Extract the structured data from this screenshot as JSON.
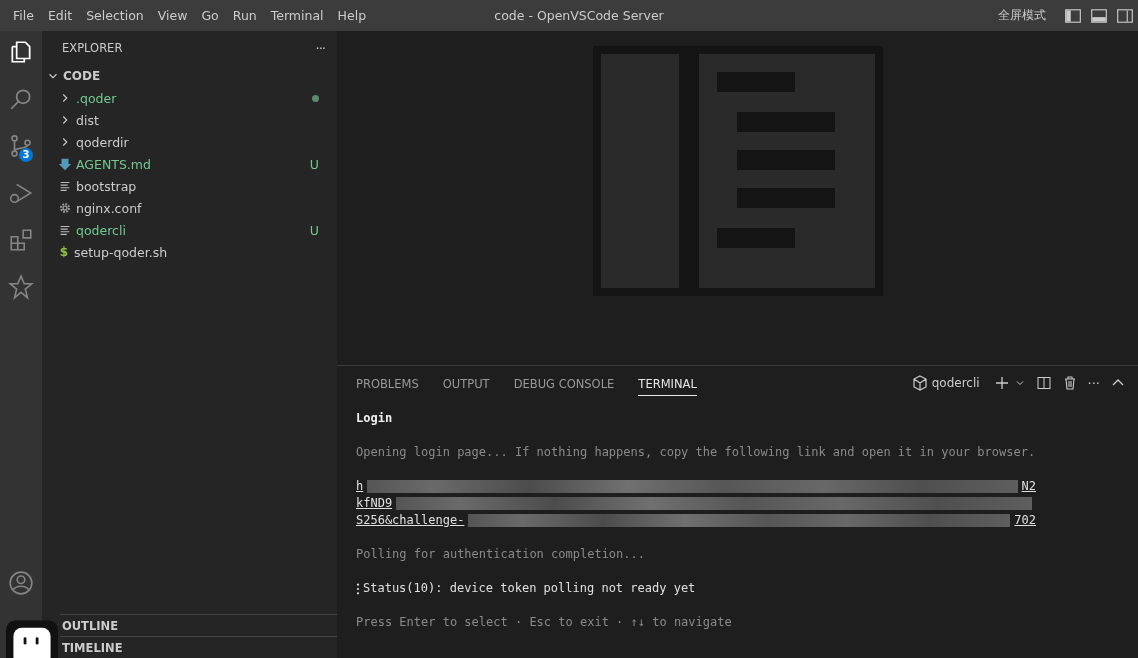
{
  "menu": [
    "File",
    "Edit",
    "Selection",
    "View",
    "Go",
    "Run",
    "Terminal",
    "Help"
  ],
  "window": {
    "title": "code - OpenVSCode Server",
    "fullscreen": "全屏模式"
  },
  "activity": [
    {
      "kind": "files",
      "selected": true
    },
    {
      "kind": "search",
      "selected": false
    },
    {
      "kind": "scm",
      "selected": false,
      "badge": "3"
    },
    {
      "kind": "debug",
      "selected": false
    },
    {
      "kind": "extensions",
      "selected": false
    },
    {
      "kind": "ai",
      "selected": false
    }
  ],
  "sidebar": {
    "title": "EXPLORER",
    "more": "···",
    "root": "CODE",
    "expanded": true,
    "items": [
      {
        "name": ".qoder",
        "kind": "folder",
        "untracked": true,
        "dot": true
      },
      {
        "name": "dist",
        "kind": "folder",
        "untracked": false
      },
      {
        "name": "qoderdir",
        "kind": "folder",
        "untracked": false
      },
      {
        "name": "AGENTS.md",
        "kind": "markdown",
        "untracked": true,
        "badge": "U"
      },
      {
        "name": "bootstrap",
        "kind": "text",
        "untracked": false
      },
      {
        "name": "nginx.conf",
        "kind": "config",
        "untracked": false
      },
      {
        "name": "qodercli",
        "kind": "text",
        "untracked": true,
        "badge": "U"
      },
      {
        "name": "setup-qoder.sh",
        "kind": "shell",
        "untracked": false,
        "glyph": "$"
      }
    ],
    "sections": [
      "OUTLINE",
      "TIMELINE"
    ]
  },
  "panel": {
    "tabs": [
      {
        "label": "PROBLEMS",
        "selected": false
      },
      {
        "label": "OUTPUT",
        "selected": false
      },
      {
        "label": "DEBUG CONSOLE",
        "selected": false
      },
      {
        "label": "TERMINAL",
        "selected": true
      }
    ],
    "terminal_name": "qodercli",
    "more": "···",
    "lines": [
      {
        "kind": "heading",
        "text": "Login"
      },
      {
        "kind": "dim",
        "text": "Opening login page... If nothing happens, copy the following link and open it in your browser."
      },
      {
        "kind": "link",
        "start": "h",
        "end": "N2"
      },
      {
        "kind": "link",
        "start": "kfND9"
      },
      {
        "kind": "link",
        "start": "S256&challenge-",
        "end": "702"
      },
      {
        "kind": "dim",
        "text": "Polling for authentication completion..."
      },
      {
        "kind": "status",
        "text": "Status(10): device token polling not ready yet"
      },
      {
        "kind": "dim",
        "text": "Press Enter to select · Esc to exit · ↑↓ to navigate"
      }
    ]
  }
}
